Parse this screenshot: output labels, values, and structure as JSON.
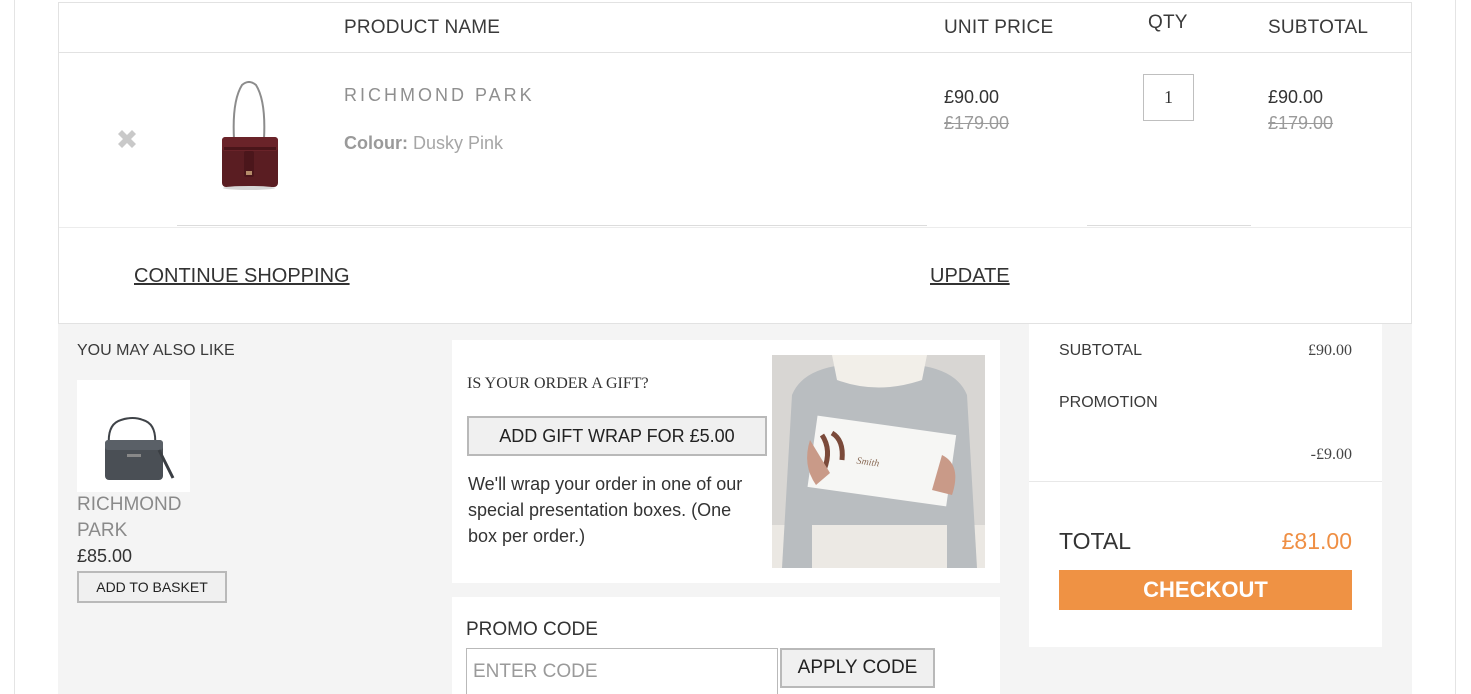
{
  "table_header": {
    "product_name": "PRODUCT NAME",
    "unit_price": "UNIT PRICE",
    "qty": "QTY",
    "subtotal": "SUBTOTAL"
  },
  "cart_item": {
    "name": "RICHMOND PARK",
    "colour_label": "Colour:",
    "colour_value": "Dusky Pink",
    "unit_price": "£90.00",
    "unit_price_old": "£179.00",
    "qty": "1",
    "subtotal": "£90.00",
    "subtotal_old": "£179.00"
  },
  "actions": {
    "continue_shopping": "CONTINUE SHOPPING",
    "update": "UPDATE"
  },
  "also_like": {
    "title": "YOU MAY ALSO LIKE",
    "product_name": "RICHMOND PARK",
    "price": "£85.00",
    "button": "ADD TO BASKET"
  },
  "gift": {
    "question": "IS YOUR ORDER A GIFT?",
    "button": "ADD GIFT WRAP FOR £5.00",
    "description": "We'll wrap your order in one of our special presentation boxes. (One box per order.)"
  },
  "promo": {
    "title": "PROMO CODE",
    "placeholder": "ENTER CODE",
    "button": "APPLY CODE"
  },
  "summary": {
    "subtotal_label": "SUBTOTAL",
    "subtotal_value": "£90.00",
    "promotion_label": "PROMOTION",
    "promotion_value": "-£9.00",
    "total_label": "TOTAL",
    "total_value": "£81.00",
    "checkout": "CHECKOUT"
  },
  "colors": {
    "accent": "#ef9244",
    "total": "#ef8f44",
    "bag_burgundy": "#5a1d22",
    "bag_grey": "#4a4f55"
  }
}
